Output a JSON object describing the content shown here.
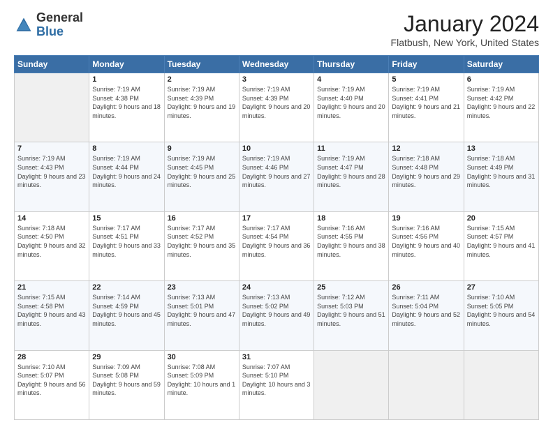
{
  "logo": {
    "general": "General",
    "blue": "Blue"
  },
  "header": {
    "title": "January 2024",
    "subtitle": "Flatbush, New York, United States"
  },
  "days_of_week": [
    "Sunday",
    "Monday",
    "Tuesday",
    "Wednesday",
    "Thursday",
    "Friday",
    "Saturday"
  ],
  "weeks": [
    [
      {
        "day": "",
        "sunrise": "",
        "sunset": "",
        "daylight": ""
      },
      {
        "day": "1",
        "sunrise": "Sunrise: 7:19 AM",
        "sunset": "Sunset: 4:38 PM",
        "daylight": "Daylight: 9 hours and 18 minutes."
      },
      {
        "day": "2",
        "sunrise": "Sunrise: 7:19 AM",
        "sunset": "Sunset: 4:39 PM",
        "daylight": "Daylight: 9 hours and 19 minutes."
      },
      {
        "day": "3",
        "sunrise": "Sunrise: 7:19 AM",
        "sunset": "Sunset: 4:39 PM",
        "daylight": "Daylight: 9 hours and 20 minutes."
      },
      {
        "day": "4",
        "sunrise": "Sunrise: 7:19 AM",
        "sunset": "Sunset: 4:40 PM",
        "daylight": "Daylight: 9 hours and 20 minutes."
      },
      {
        "day": "5",
        "sunrise": "Sunrise: 7:19 AM",
        "sunset": "Sunset: 4:41 PM",
        "daylight": "Daylight: 9 hours and 21 minutes."
      },
      {
        "day": "6",
        "sunrise": "Sunrise: 7:19 AM",
        "sunset": "Sunset: 4:42 PM",
        "daylight": "Daylight: 9 hours and 22 minutes."
      }
    ],
    [
      {
        "day": "7",
        "sunrise": "Sunrise: 7:19 AM",
        "sunset": "Sunset: 4:43 PM",
        "daylight": "Daylight: 9 hours and 23 minutes."
      },
      {
        "day": "8",
        "sunrise": "Sunrise: 7:19 AM",
        "sunset": "Sunset: 4:44 PM",
        "daylight": "Daylight: 9 hours and 24 minutes."
      },
      {
        "day": "9",
        "sunrise": "Sunrise: 7:19 AM",
        "sunset": "Sunset: 4:45 PM",
        "daylight": "Daylight: 9 hours and 25 minutes."
      },
      {
        "day": "10",
        "sunrise": "Sunrise: 7:19 AM",
        "sunset": "Sunset: 4:46 PM",
        "daylight": "Daylight: 9 hours and 27 minutes."
      },
      {
        "day": "11",
        "sunrise": "Sunrise: 7:19 AM",
        "sunset": "Sunset: 4:47 PM",
        "daylight": "Daylight: 9 hours and 28 minutes."
      },
      {
        "day": "12",
        "sunrise": "Sunrise: 7:18 AM",
        "sunset": "Sunset: 4:48 PM",
        "daylight": "Daylight: 9 hours and 29 minutes."
      },
      {
        "day": "13",
        "sunrise": "Sunrise: 7:18 AM",
        "sunset": "Sunset: 4:49 PM",
        "daylight": "Daylight: 9 hours and 31 minutes."
      }
    ],
    [
      {
        "day": "14",
        "sunrise": "Sunrise: 7:18 AM",
        "sunset": "Sunset: 4:50 PM",
        "daylight": "Daylight: 9 hours and 32 minutes."
      },
      {
        "day": "15",
        "sunrise": "Sunrise: 7:17 AM",
        "sunset": "Sunset: 4:51 PM",
        "daylight": "Daylight: 9 hours and 33 minutes."
      },
      {
        "day": "16",
        "sunrise": "Sunrise: 7:17 AM",
        "sunset": "Sunset: 4:52 PM",
        "daylight": "Daylight: 9 hours and 35 minutes."
      },
      {
        "day": "17",
        "sunrise": "Sunrise: 7:17 AM",
        "sunset": "Sunset: 4:54 PM",
        "daylight": "Daylight: 9 hours and 36 minutes."
      },
      {
        "day": "18",
        "sunrise": "Sunrise: 7:16 AM",
        "sunset": "Sunset: 4:55 PM",
        "daylight": "Daylight: 9 hours and 38 minutes."
      },
      {
        "day": "19",
        "sunrise": "Sunrise: 7:16 AM",
        "sunset": "Sunset: 4:56 PM",
        "daylight": "Daylight: 9 hours and 40 minutes."
      },
      {
        "day": "20",
        "sunrise": "Sunrise: 7:15 AM",
        "sunset": "Sunset: 4:57 PM",
        "daylight": "Daylight: 9 hours and 41 minutes."
      }
    ],
    [
      {
        "day": "21",
        "sunrise": "Sunrise: 7:15 AM",
        "sunset": "Sunset: 4:58 PM",
        "daylight": "Daylight: 9 hours and 43 minutes."
      },
      {
        "day": "22",
        "sunrise": "Sunrise: 7:14 AM",
        "sunset": "Sunset: 4:59 PM",
        "daylight": "Daylight: 9 hours and 45 minutes."
      },
      {
        "day": "23",
        "sunrise": "Sunrise: 7:13 AM",
        "sunset": "Sunset: 5:01 PM",
        "daylight": "Daylight: 9 hours and 47 minutes."
      },
      {
        "day": "24",
        "sunrise": "Sunrise: 7:13 AM",
        "sunset": "Sunset: 5:02 PM",
        "daylight": "Daylight: 9 hours and 49 minutes."
      },
      {
        "day": "25",
        "sunrise": "Sunrise: 7:12 AM",
        "sunset": "Sunset: 5:03 PM",
        "daylight": "Daylight: 9 hours and 51 minutes."
      },
      {
        "day": "26",
        "sunrise": "Sunrise: 7:11 AM",
        "sunset": "Sunset: 5:04 PM",
        "daylight": "Daylight: 9 hours and 52 minutes."
      },
      {
        "day": "27",
        "sunrise": "Sunrise: 7:10 AM",
        "sunset": "Sunset: 5:05 PM",
        "daylight": "Daylight: 9 hours and 54 minutes."
      }
    ],
    [
      {
        "day": "28",
        "sunrise": "Sunrise: 7:10 AM",
        "sunset": "Sunset: 5:07 PM",
        "daylight": "Daylight: 9 hours and 56 minutes."
      },
      {
        "day": "29",
        "sunrise": "Sunrise: 7:09 AM",
        "sunset": "Sunset: 5:08 PM",
        "daylight": "Daylight: 9 hours and 59 minutes."
      },
      {
        "day": "30",
        "sunrise": "Sunrise: 7:08 AM",
        "sunset": "Sunset: 5:09 PM",
        "daylight": "Daylight: 10 hours and 1 minute."
      },
      {
        "day": "31",
        "sunrise": "Sunrise: 7:07 AM",
        "sunset": "Sunset: 5:10 PM",
        "daylight": "Daylight: 10 hours and 3 minutes."
      },
      {
        "day": "",
        "sunrise": "",
        "sunset": "",
        "daylight": ""
      },
      {
        "day": "",
        "sunrise": "",
        "sunset": "",
        "daylight": ""
      },
      {
        "day": "",
        "sunrise": "",
        "sunset": "",
        "daylight": ""
      }
    ]
  ]
}
